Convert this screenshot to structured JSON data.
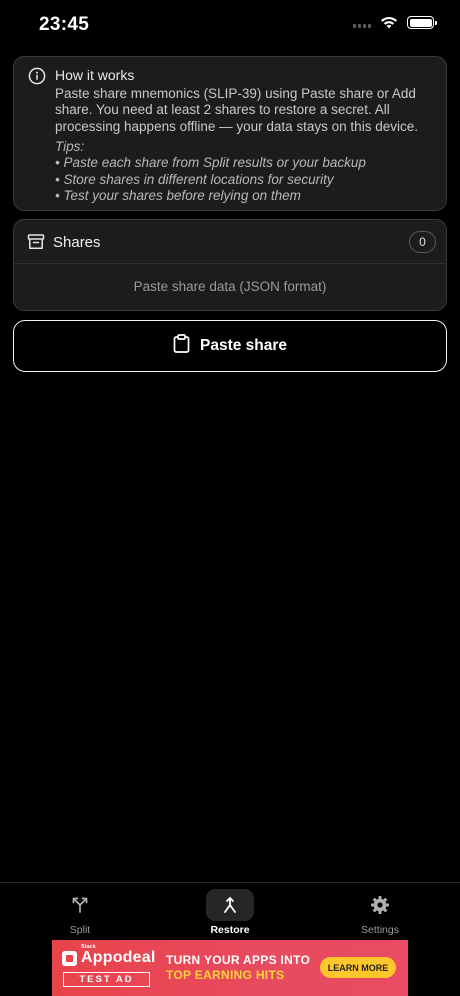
{
  "status_bar": {
    "time": "23:45",
    "icons": [
      "cellular-signal-icon",
      "wifi-icon",
      "battery-icon"
    ],
    "battery_level": 1.0
  },
  "info": {
    "icon": "info-circle-icon",
    "title": "How it works",
    "body": "Paste share mnemonics (SLIP-39) using Paste share or Add share. You need at least 2 shares to restore a secret. All processing happens offline — your data stays on this device.",
    "tips_heading": "Tips:",
    "tips": [
      "• Paste each share from Split results or your backup",
      "• Store shares in different locations for security",
      "• Test your shares before relying on them"
    ]
  },
  "shares": {
    "icon": "archive-box-icon",
    "title": "Shares",
    "count": "0",
    "empty_text": "Paste share data (JSON format)"
  },
  "paste_button": {
    "icon": "clipboard-icon",
    "label": "Paste share"
  },
  "tab_bar": {
    "active": "Restore",
    "tabs": [
      {
        "label": "Split",
        "icon": "split-arrows-icon"
      },
      {
        "label": "Restore",
        "icon": "merge-arrow-icon"
      },
      {
        "label": "Settings",
        "icon": "gear-icon"
      }
    ]
  },
  "ad": {
    "small_text": "Stack",
    "brand": "Appodeal",
    "badge": "TEST AD",
    "line1": "TURN YOUR APPS INTO",
    "line2": "TOP EARNING HITS",
    "cta": "LEARN MORE",
    "colors": {
      "background": "#e8434a",
      "highlight": "#ffd23c",
      "cta": "#ffc72c"
    }
  }
}
